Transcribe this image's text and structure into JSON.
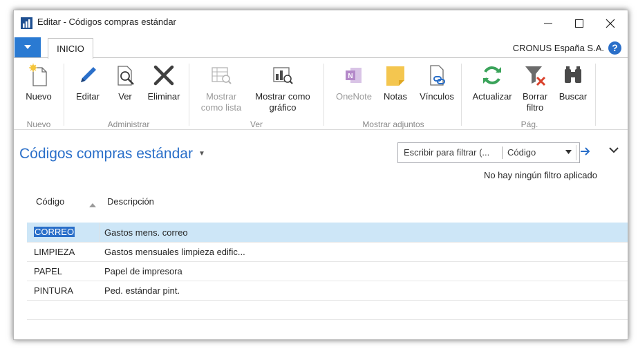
{
  "window": {
    "title": "Editar - Códigos compras estándar"
  },
  "tabs": {
    "active": "INICIO"
  },
  "header": {
    "company": "CRONUS España S.A.",
    "help": "?"
  },
  "ribbon": {
    "groups": [
      {
        "name": "Nuevo",
        "buttons": [
          {
            "label": "Nuevo",
            "icon": "new-document-icon",
            "enabled": true
          }
        ]
      },
      {
        "name": "Administrar",
        "buttons": [
          {
            "label": "Editar",
            "icon": "pencil-icon",
            "enabled": true
          },
          {
            "label": "Ver",
            "icon": "view-document-icon",
            "enabled": true
          },
          {
            "label": "Eliminar",
            "icon": "delete-x-icon",
            "enabled": true
          }
        ]
      },
      {
        "name": "Ver",
        "buttons": [
          {
            "label": "Mostrar como lista",
            "icon": "list-view-icon",
            "enabled": false
          },
          {
            "label": "Mostrar como gráfico",
            "icon": "chart-view-icon",
            "enabled": true
          }
        ]
      },
      {
        "name": "Mostrar adjuntos",
        "buttons": [
          {
            "label": "OneNote",
            "icon": "onenote-icon",
            "enabled": false
          },
          {
            "label": "Notas",
            "icon": "note-icon",
            "enabled": true
          },
          {
            "label": "Vínculos",
            "icon": "links-icon",
            "enabled": true
          }
        ]
      },
      {
        "name": "Pág.",
        "buttons": [
          {
            "label": "Actualizar",
            "icon": "refresh-icon",
            "enabled": true
          },
          {
            "label": "Borrar filtro",
            "icon": "clear-filter-icon",
            "enabled": true
          },
          {
            "label": "Buscar",
            "icon": "binoculars-icon",
            "enabled": true
          }
        ]
      }
    ],
    "labels": {
      "nuevo": "Nuevo",
      "editar": "Editar",
      "ver": "Ver",
      "eliminar": "Eliminar",
      "mostrar_lista_1": "Mostrar",
      "mostrar_lista_2": "como lista",
      "mostrar_grafico_1": "Mostrar como",
      "mostrar_grafico_2": "gráfico",
      "onenote": "OneNote",
      "notas": "Notas",
      "vinculos": "Vínculos",
      "actualizar": "Actualizar",
      "borrar_filtro_1": "Borrar",
      "borrar_filtro_2": "filtro",
      "buscar": "Buscar",
      "group_nuevo": "Nuevo",
      "group_administrar": "Administrar",
      "group_ver": "Ver",
      "group_adjuntos": "Mostrar adjuntos",
      "group_pag": "Pág."
    }
  },
  "page": {
    "title": "Códigos compras estándar",
    "filter_placeholder": "Escribir para filtrar (...",
    "filter_field": "Código",
    "no_filter": "No hay ningún filtro aplicado"
  },
  "table": {
    "columns": [
      "Código",
      "Descripción"
    ],
    "rows": [
      {
        "code": "CORREO",
        "description": "Gastos mens. correo",
        "selected": true
      },
      {
        "code": "LIMPIEZA",
        "description": "Gastos mensuales limpieza edific...",
        "selected": false
      },
      {
        "code": "PAPEL",
        "description": "Papel de impresora",
        "selected": false
      },
      {
        "code": "PINTURA",
        "description": "Ped. estándar pint.",
        "selected": false
      }
    ]
  },
  "colors": {
    "accent": "#2a6fc9",
    "selected_row": "#cde6f7",
    "menu_button": "#2a7ad2"
  }
}
